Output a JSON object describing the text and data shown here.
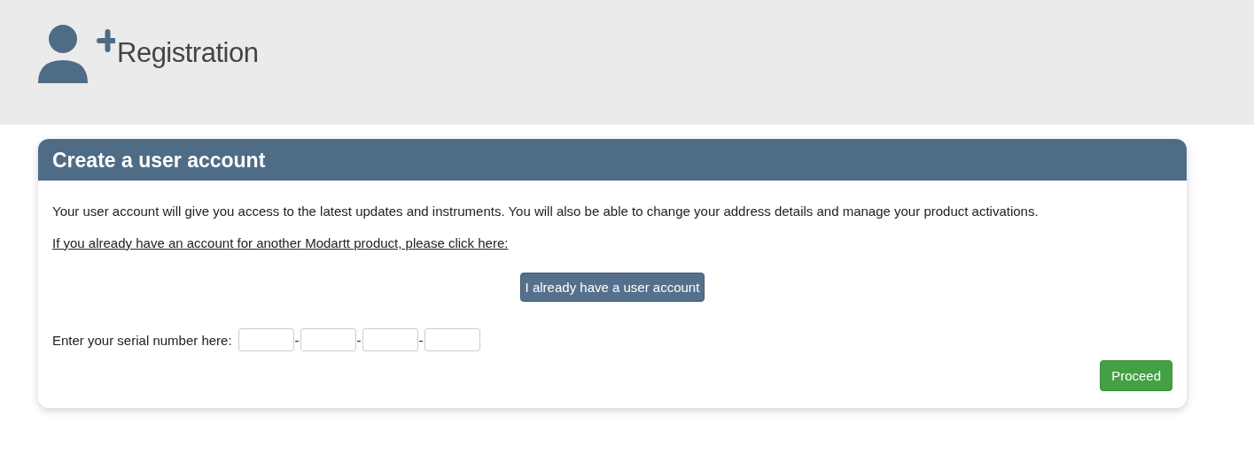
{
  "header": {
    "title": "Registration"
  },
  "panel": {
    "title": "Create a user account",
    "intro": "Your user account will give you access to the latest updates and instruments. You will also be able to change your address details and manage your product activations.",
    "link": "If you already have an account for another Modartt product, please click here:",
    "existing_button": "I already have a user account",
    "serial": {
      "label": "Enter your serial number here:",
      "parts": [
        {
          "kind": "field"
        },
        {
          "kind": "separator",
          "text": "-"
        },
        {
          "kind": "field"
        },
        {
          "kind": "separator",
          "text": "-"
        },
        {
          "kind": "field"
        },
        {
          "kind": "separator",
          "text": "-"
        },
        {
          "kind": "field"
        }
      ]
    },
    "proceed_button": "Proceed"
  }
}
